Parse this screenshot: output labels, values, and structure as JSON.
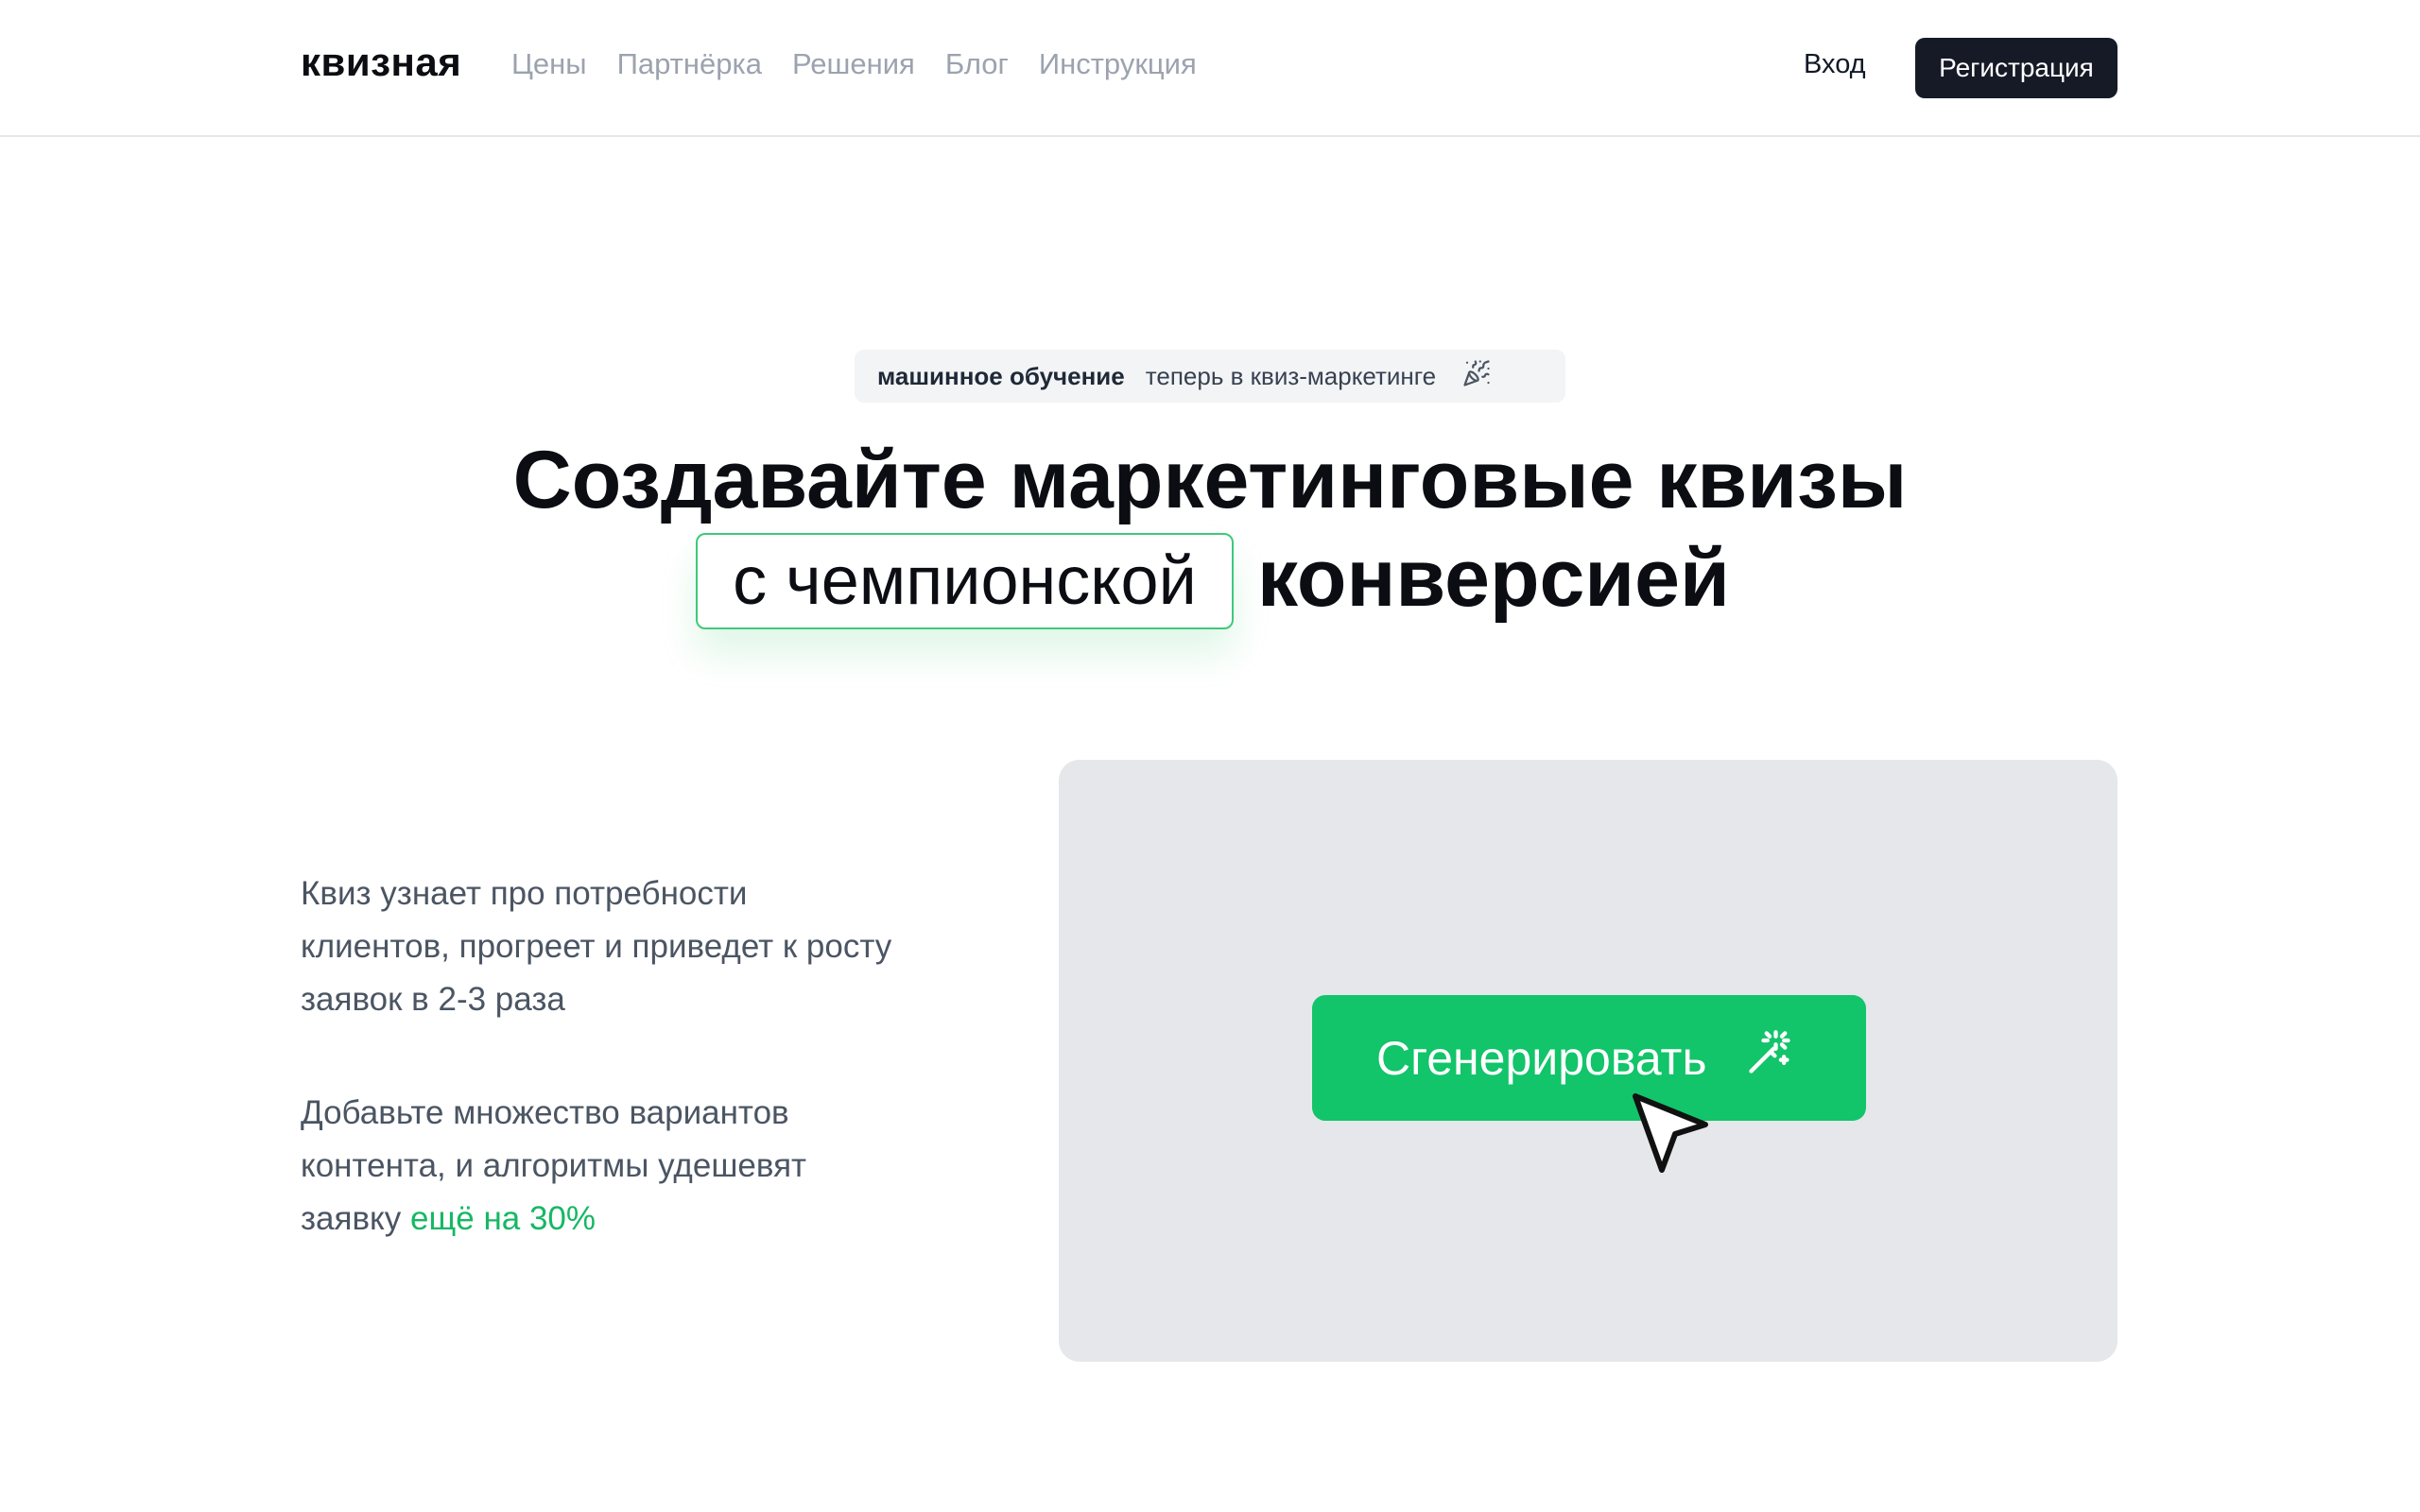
{
  "header": {
    "logo": "квизная",
    "nav": [
      "Цены",
      "Партнёрка",
      "Решения",
      "Блог",
      "Инструкция"
    ],
    "login_label": "Вход",
    "register_label": "Регистрация"
  },
  "hero": {
    "badge_strong": "машинное обучение",
    "badge_text": "теперь в квиз-маркетинге",
    "badge_icon": "party-popper-icon",
    "title_line1": "Создавайте маркетинговые квизы",
    "title_highlight": "с чемпионской",
    "title_line2_rest": "конверсией"
  },
  "content": {
    "paragraph1": "Квиз узнает про потребности клиентов, прогреет и приведет к росту заявок в 2-3 раза",
    "paragraph2_text": "Добавьте множество вариантов контента, и алгоритмы удешевят заявку",
    "paragraph2_accent": "ещё на 30%"
  },
  "demo": {
    "generate_label": "Сгенерировать",
    "generate_icon": "magic-wand-icon",
    "cursor_icon": "pointer-cursor-icon"
  },
  "colors": {
    "accent": "#12c46a",
    "dark_button": "#161a26",
    "panel": "#e5e7eb"
  }
}
